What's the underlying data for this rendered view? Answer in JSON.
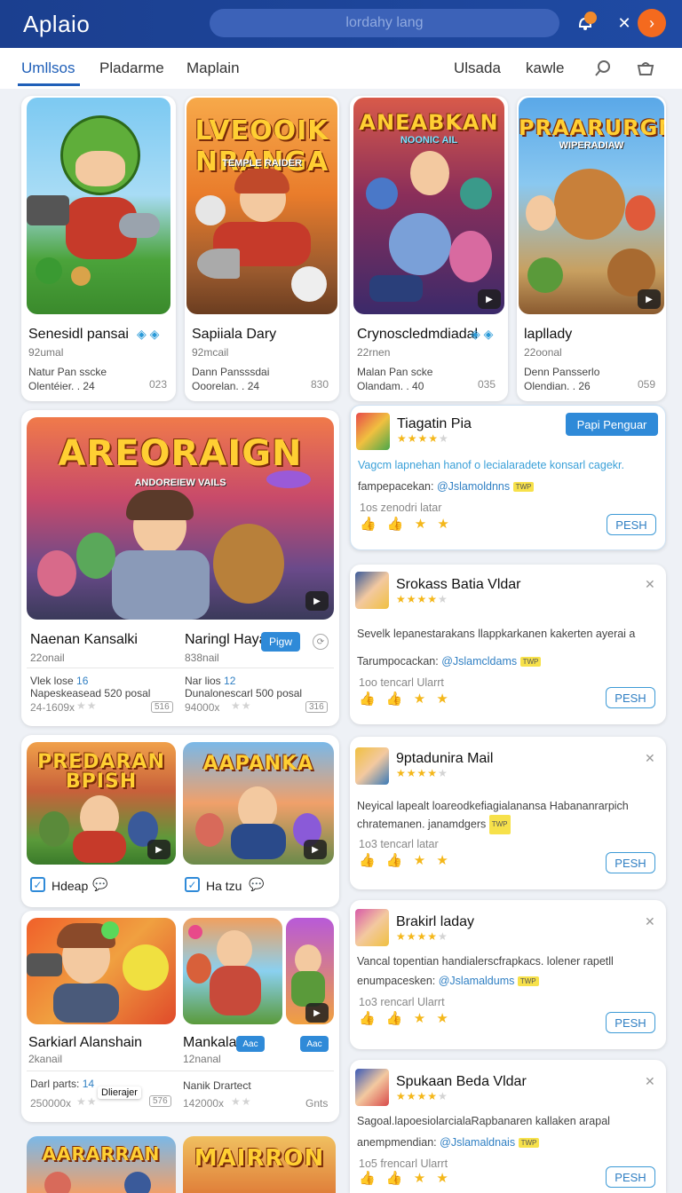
{
  "app": {
    "title": "Aplaio",
    "search_placeholder": "lordahy lang"
  },
  "tabs": [
    "Umllsos",
    "Pladarme",
    "Maplain",
    "Ulsada",
    "kawle"
  ],
  "top_games": [
    {
      "title": "Senesidl pansai",
      "sub": "92umal",
      "line1": "Natur Pan sscke",
      "line2": "Olentéier. . 24",
      "num": "023",
      "art_title": ""
    },
    {
      "title": "Sapiiala Dary",
      "sub": "92mcail",
      "line1": "Dann Pansssdai",
      "line2": "Ooorelan. . 24",
      "num": "830",
      "art_title": "LVEOOIK NRANGA",
      "art_sub": "TEMPLE RAIDER"
    },
    {
      "title": "Crynoscledmdiadal",
      "sub": "22rnen",
      "line1": "Malan Pan scke",
      "line2": "Olandam. . 40",
      "num": "035",
      "art_title": "ANEABKAN",
      "art_sub": "NOONIC AIL"
    },
    {
      "title": "lapllady",
      "sub": "22oonal",
      "line1": "Denn Pansserlo",
      "line2": "Olendian. . 26",
      "num": "059",
      "art_title": "PRAARURGN",
      "art_sub": "WIPERADIAW"
    }
  ],
  "featured": {
    "art_title": "AREORAIGN",
    "art_sub": "ANDOREIEW VAILS",
    "left": {
      "title": "Naenan Kansalki",
      "sub": "22onail",
      "line1a": "Vlek lose ",
      "line1b": "16",
      "line2": "Napeskeasead 520 posal",
      "line3": "24-1609x",
      "tag": "516"
    },
    "right": {
      "title": "Naringl Haya",
      "btn": "Pigw",
      "sub": "838nail",
      "line1a": "Nar lios ",
      "line1b": "12",
      "line2": "Dunalonescarl 500 posal",
      "line3": "94000x",
      "tag": "316"
    }
  },
  "grid_a": [
    {
      "art_title": "PREDARAN BPISH",
      "label": "Hdeap"
    },
    {
      "art_title": "AAPANKA",
      "label": "Ha tzu"
    }
  ],
  "grid_b": {
    "left": {
      "title": "Sarkiarl Alanshain",
      "sub": "2kanail",
      "line1a": "Darl parts: ",
      "line1b": "14",
      "tooltip": "Dlierajer",
      "line2": "250000x",
      "tag": "576"
    },
    "right": {
      "title": "Mankala",
      "btn1": "Aac",
      "btn2": "Aac",
      "sub": "12nanal",
      "line1": "Nanik Drartect",
      "line2": "142000x",
      "tag": "Gnts"
    }
  },
  "bottom_arts": [
    "AARARRAN",
    "MAIRRON"
  ],
  "side_cards": [
    {
      "title": "Tiagatin Pia",
      "btn": "Papi Penguar",
      "desc": "Vagcm lapnehan hanof o lecialaradete konsarl cagekr.",
      "line": "fampepacekan: ",
      "link": "@Jslamoldnns",
      "meta": "1os  zenodri latar",
      "action": "PESH",
      "highlight": true
    },
    {
      "title": "Srokass Batia Vldar",
      "desc": "Sevelk lepanestarakans llappkarkanen kakerten ayerai a",
      "line": "Tarumpocackan: ",
      "link": "@Jslamcldams",
      "meta": "1oo  tencarl Ularrt",
      "action": "PESH"
    },
    {
      "title": "9ptadunira Mail",
      "desc": "Neyical lapealt loareodkefiagialanansa Habananrarpich chratemanen. ",
      "line": "",
      "link": "",
      "extra": "janamdgers",
      "meta": "1o3  tencarl latar",
      "action": "PESH"
    },
    {
      "title": "Brakirl laday",
      "desc": "Vancal topentian handialerscfrapkacs. lolener rapetll",
      "line": "enumpacesken: ",
      "link": "@Jslamaldums",
      "meta": "1o3  rencarl Ularrt",
      "action": "PESH"
    },
    {
      "title": "Spukaan Beda Vldar",
      "desc": "Sagoal.lapoesiolarcialaRapbanaren kallaken arapal",
      "line": "anempmendian: ",
      "link": "@Jslamaldnais",
      "meta": "1o5  frencarl Ularrt",
      "action": "PESH"
    }
  ],
  "colors": {
    "header": "#1b3f8f",
    "accent": "#2f8ad8",
    "star": "#f4b71a",
    "orange": "#f46a1e"
  }
}
